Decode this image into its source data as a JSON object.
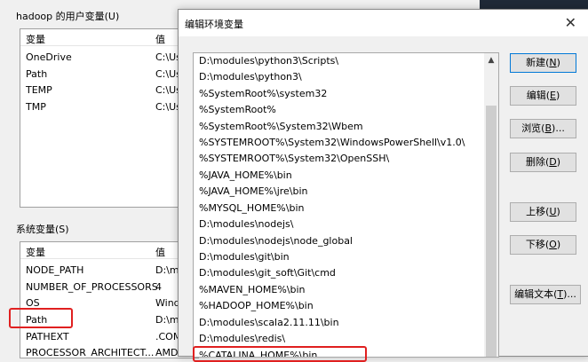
{
  "background": {
    "user_group_label": "hadoop 的用户变量(U)",
    "user_columns": [
      "变量",
      "值"
    ],
    "user_rows": [
      {
        "name": "OneDrive",
        "value": "C:\\Us"
      },
      {
        "name": "Path",
        "value": "C:\\Us"
      },
      {
        "name": "TEMP",
        "value": "C:\\Us"
      },
      {
        "name": "TMP",
        "value": "C:\\Us"
      }
    ],
    "system_group_label": "系统变量(S)",
    "system_columns": [
      "变量",
      "值"
    ],
    "system_rows": [
      {
        "name": "NODE_PATH",
        "value": "D:\\m"
      },
      {
        "name": "NUMBER_OF_PROCESSORS",
        "value": "4"
      },
      {
        "name": "OS",
        "value": "Wind"
      },
      {
        "name": "Path",
        "value": "D:\\m"
      },
      {
        "name": "PATHEXT",
        "value": ".COM"
      },
      {
        "name": "PROCESSOR_ARCHITECT...",
        "value": "AMD"
      }
    ]
  },
  "dialog": {
    "title": "编辑环境变量",
    "close_glyph": "✕",
    "scroll_up_glyph": "▲",
    "paths": [
      "D:\\modules\\python3\\Scripts\\",
      "D:\\modules\\python3\\",
      "%SystemRoot%\\system32",
      "%SystemRoot%",
      "%SystemRoot%\\System32\\Wbem",
      "%SYSTEMROOT%\\System32\\WindowsPowerShell\\v1.0\\",
      "%SYSTEMROOT%\\System32\\OpenSSH\\",
      "%JAVA_HOME%\\bin",
      "%JAVA_HOME%\\jre\\bin",
      "%MYSQL_HOME%\\bin",
      "D:\\modules\\nodejs\\",
      "D:\\modules\\nodejs\\node_global",
      "D:\\modules\\git\\bin",
      "D:\\modules\\git_soft\\Git\\cmd",
      "%MAVEN_HOME%\\bin",
      "%HADOOP_HOME%\\bin",
      "D:\\modules\\scala2.11.11\\bin",
      "D:\\modules\\redis\\",
      "%CATALINA_HOME%\\bin"
    ],
    "buttons": {
      "new": {
        "text": "新建(",
        "key": "N",
        "end": ")"
      },
      "edit": {
        "text": "编辑(",
        "key": "E",
        "end": ")"
      },
      "browse": {
        "text": "浏览(",
        "key": "B",
        "end": ")..."
      },
      "delete": {
        "text": "删除(",
        "key": "D",
        "end": ")"
      },
      "up": {
        "text": "上移(",
        "key": "U",
        "end": ")"
      },
      "down": {
        "text": "下移(",
        "key": "O",
        "end": ")"
      },
      "edit_text": {
        "text": "编辑文本(",
        "key": "T",
        "end": ")..."
      }
    }
  }
}
